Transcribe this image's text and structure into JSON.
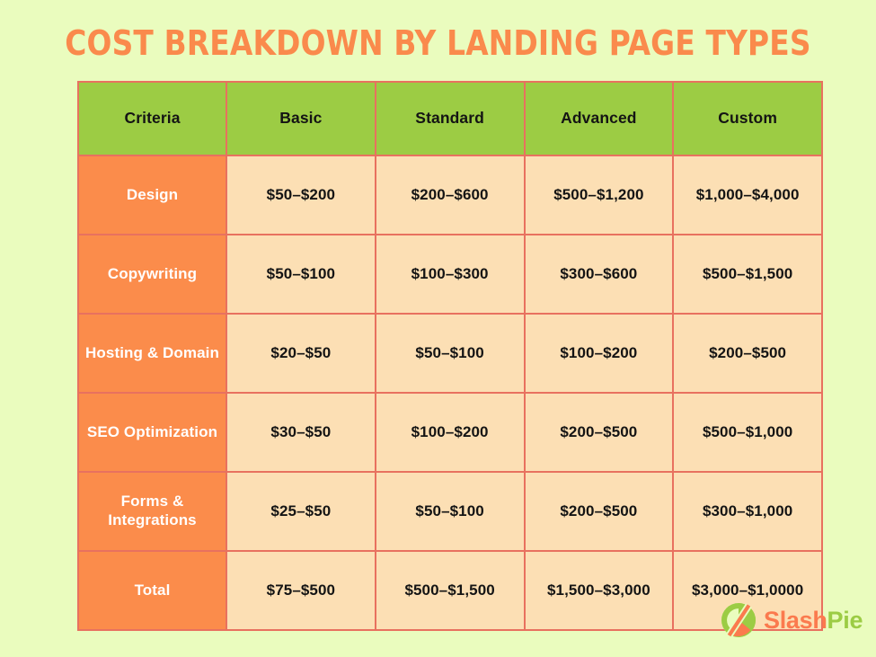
{
  "title": "COST BREAKDOWN BY LANDING PAGE TYPES",
  "colors": {
    "background": "#eafcbe",
    "title": "#fa8a4c",
    "header_cell": "#9ccc44",
    "row_label_cell": "#fb8c4b",
    "value_cell": "#fcdfb4",
    "border": "#e8715f",
    "header_text": "#141414",
    "row_label_text": "#ffffff",
    "value_text": "#141414",
    "logo_orange": "#fb7a4e",
    "logo_green": "#9ccc44"
  },
  "table": {
    "headers": [
      "Criteria",
      "Basic",
      "Standard",
      "Advanced",
      "Custom"
    ],
    "rows": [
      {
        "label": "Design",
        "values": [
          "$50–$200",
          "$200–$600",
          "$500–$1,200",
          "$1,000–$4,000"
        ]
      },
      {
        "label": "Copywriting",
        "values": [
          "$50–$100",
          "$100–$300",
          "$300–$600",
          "$500–$1,500"
        ]
      },
      {
        "label": "Hosting & Domain",
        "values": [
          "$20–$50",
          "$50–$100",
          "$100–$200",
          "$200–$500"
        ]
      },
      {
        "label": "SEO Optimization",
        "values": [
          "$30–$50",
          "$100–$200",
          "$200–$500",
          "$500–$1,000"
        ]
      },
      {
        "label": "Forms & Integrations",
        "values": [
          "$25–$50",
          "$50–$100",
          "$200–$500",
          "$300–$1,000"
        ]
      },
      {
        "label": "Total",
        "values": [
          "$75–$500",
          "$500–$1,500",
          "$1,500–$3,000",
          "$3,000–$1,0000"
        ]
      }
    ]
  },
  "logo": {
    "mark": "slashpie-circle-mark",
    "name_part1": "Slash",
    "name_part2": "Pie"
  }
}
